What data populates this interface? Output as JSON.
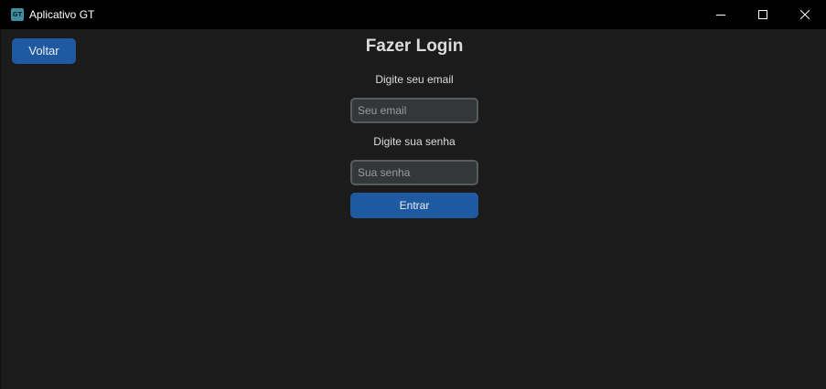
{
  "window": {
    "title": "Aplicativo GT",
    "icon_text": "GT",
    "icon_name": "app-icon",
    "controls": [
      "minimize-icon",
      "maximize-icon",
      "close-icon"
    ]
  },
  "nav": {
    "back_label": "Voltar"
  },
  "login": {
    "title": "Fazer Login",
    "email_label": "Digite seu email",
    "email_placeholder": "Seu email",
    "email_value": "",
    "password_label": "Digite sua senha",
    "password_placeholder": "Sua senha",
    "password_value": "",
    "submit_label": "Entrar"
  },
  "colors": {
    "background": "#1b1b1b",
    "titlebar": "#000000",
    "accent": "#1f5aa0",
    "input_bg": "#343638",
    "input_border": "#565b5e",
    "text": "#dcdcdc"
  }
}
